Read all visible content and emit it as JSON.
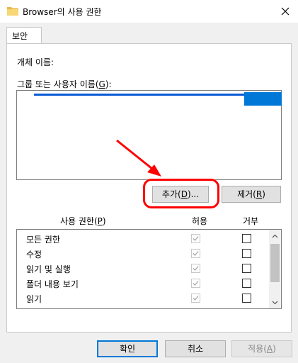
{
  "window": {
    "title": "Browser의 사용 권한",
    "icon": "folder-icon",
    "close_icon": "close-icon"
  },
  "tabs": [
    {
      "label": "보안",
      "selected": true
    }
  ],
  "object_name": {
    "label": "개체 이름:"
  },
  "groups": {
    "label_prefix": "그룹 또는 사용자 이름(",
    "label_key": "G",
    "label_suffix": "):",
    "selected_item_text": ""
  },
  "buttons": {
    "add": {
      "prefix": "추가(",
      "key": "D",
      "suffix": ")..."
    },
    "remove": {
      "prefix": "제거(",
      "key": "R",
      "suffix": ")"
    },
    "ok": "확인",
    "cancel": "취소",
    "apply": {
      "prefix": "적용(",
      "key": "A",
      "suffix": ")"
    }
  },
  "permissions": {
    "header_prefix": "사용 권한(",
    "header_key": "P",
    "header_suffix": ")",
    "allow_header": "허용",
    "deny_header": "거부",
    "rows": [
      {
        "name": "모든 권한",
        "allow": true,
        "deny": false
      },
      {
        "name": "수정",
        "allow": true,
        "deny": false
      },
      {
        "name": "읽기 및 실행",
        "allow": true,
        "deny": false
      },
      {
        "name": "폴더 내용 보기",
        "allow": true,
        "deny": false
      },
      {
        "name": "읽기",
        "allow": true,
        "deny": false
      }
    ]
  },
  "colors": {
    "selection": "#0078d7",
    "annotation": "#ff0000"
  }
}
